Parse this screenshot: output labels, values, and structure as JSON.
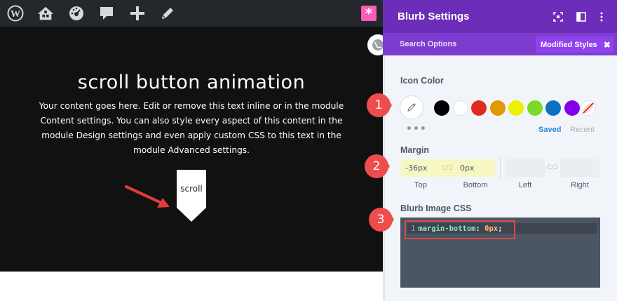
{
  "admin_bar": {
    "icons": [
      "wordpress-icon",
      "home-network-icon",
      "dashboard-icon",
      "comment-icon",
      "plus-icon",
      "pencil-icon"
    ],
    "settings_glyph": "*"
  },
  "module": {
    "title": "scroll button animation",
    "body": "Your content goes here. Edit or remove this text inline or in the module Content settings. You can also style every aspect of this content in the module Design settings and even apply custom CSS to this text in the module Advanced settings.",
    "scroll_label": "scroll"
  },
  "panel": {
    "title": "Blurb Settings",
    "search_label": "Search Options",
    "modified_styles_label": "Modified Styles",
    "modified_close": "✖",
    "icon_color": {
      "label": "Icon Color",
      "swatches": [
        "#000000",
        "#ffffff",
        "#e02b20",
        "#e09900",
        "#edf000",
        "#7cda24",
        "#0c71c3",
        "#8300e9"
      ],
      "more": "•••",
      "saved_label": "Saved",
      "recent_label": "Recent"
    },
    "margin": {
      "label": "Margin",
      "top_value": "-36px",
      "bottom_value": "0px",
      "left_value": "",
      "right_value": "",
      "top_label": "Top",
      "bottom_label": "Bottom",
      "left_label": "Left",
      "right_label": "Right",
      "link_glyph": "C/Ɔ"
    },
    "image_css": {
      "label": "Blurb Image CSS",
      "line_number": "1",
      "property": "margin-bottom",
      "colon": ":",
      "value": "0px",
      "semicolon": ";"
    }
  },
  "annotations": {
    "markers": [
      "1",
      "2",
      "3"
    ],
    "marker_color": "#ee4d4d"
  },
  "colors": {
    "header_purple": "#6c2eb9",
    "tabs_purple": "#7e3bd0",
    "accent_pink": "#ff5ab4",
    "accent_blue": "#2b87da"
  }
}
